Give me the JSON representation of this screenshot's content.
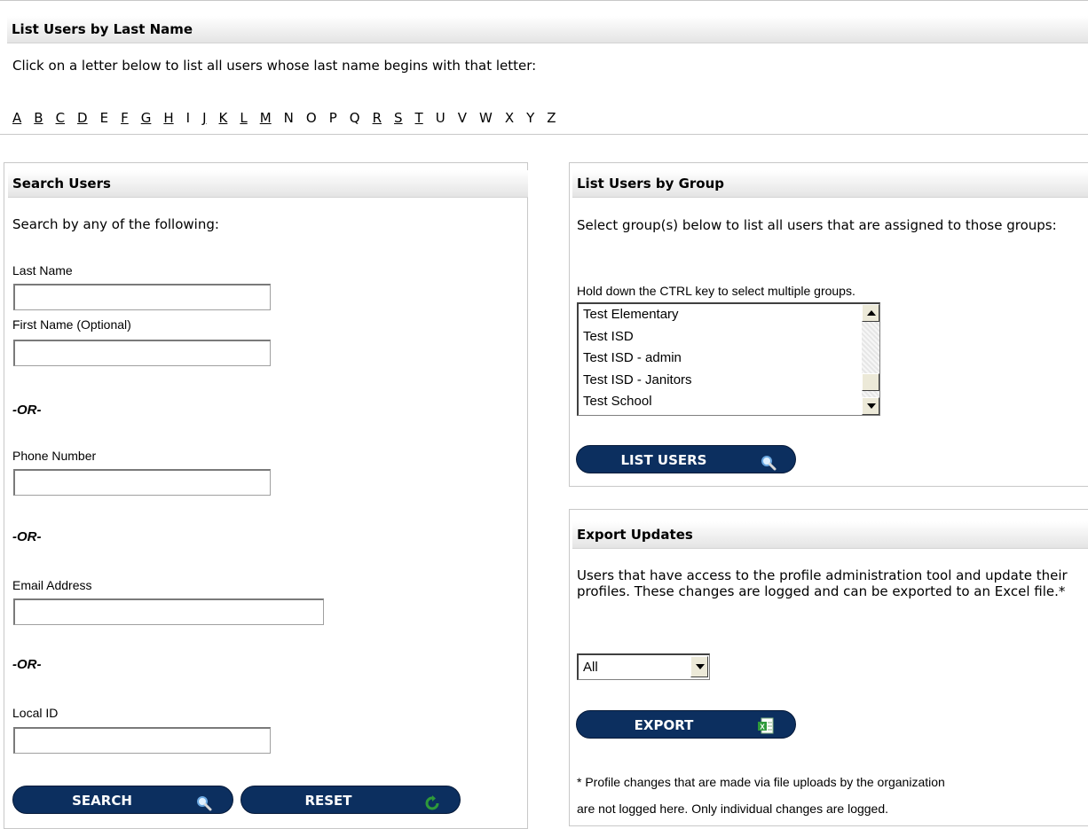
{
  "last_name_panel": {
    "title": "List Users by Last Name",
    "instructions": "Click on a letter below to list all users whose last name begins with that letter:",
    "letters": [
      {
        "letter": "A",
        "link": true
      },
      {
        "letter": "B",
        "link": true
      },
      {
        "letter": "C",
        "link": true
      },
      {
        "letter": "D",
        "link": true
      },
      {
        "letter": "E",
        "link": false
      },
      {
        "letter": "F",
        "link": true
      },
      {
        "letter": "G",
        "link": true
      },
      {
        "letter": "H",
        "link": true
      },
      {
        "letter": "I",
        "link": false
      },
      {
        "letter": "J",
        "link": true
      },
      {
        "letter": "K",
        "link": true
      },
      {
        "letter": "L",
        "link": true
      },
      {
        "letter": "M",
        "link": true
      },
      {
        "letter": "N",
        "link": false
      },
      {
        "letter": "O",
        "link": false
      },
      {
        "letter": "P",
        "link": false
      },
      {
        "letter": "Q",
        "link": false
      },
      {
        "letter": "R",
        "link": true
      },
      {
        "letter": "S",
        "link": true
      },
      {
        "letter": "T",
        "link": true
      },
      {
        "letter": "U",
        "link": false
      },
      {
        "letter": "V",
        "link": false
      },
      {
        "letter": "W",
        "link": false
      },
      {
        "letter": "X",
        "link": false
      },
      {
        "letter": "Y",
        "link": false
      },
      {
        "letter": "Z",
        "link": false
      }
    ]
  },
  "search_panel": {
    "title": "Search Users",
    "subtitle": "Search by any of the following:",
    "last_name_label": "Last Name",
    "last_name_value": "",
    "first_name_label": "First Name (Optional)",
    "first_name_value": "",
    "or_label": "-OR-",
    "phone_label": "Phone Number",
    "phone_value": "",
    "email_label": "Email Address",
    "email_value": "",
    "local_id_label": "Local ID",
    "local_id_value": "",
    "search_button": "SEARCH",
    "reset_button": "RESET"
  },
  "group_panel": {
    "title": "List Users by Group",
    "instructions": "Select group(s) below to list all users that are assigned to those groups:",
    "hint": "Hold down the CTRL key to select multiple groups.",
    "groups": [
      "Test Elementary",
      "Test ISD",
      "Test ISD - admin",
      "Test ISD - Janitors",
      "Test School"
    ],
    "list_button": "LIST USERS"
  },
  "export_panel": {
    "title": "Export Updates",
    "description": "Users that have access to the profile administration tool and update their profiles. These changes are logged and can be exported to an Excel file.*",
    "select_value": "All",
    "export_button": "EXPORT",
    "footnote_line1": "* Profile changes that are made via file uploads by the organization",
    "footnote_line2": "are not logged here. Only individual changes are logged."
  },
  "colors": {
    "button_bg": "#0c2f5f",
    "header_grad_end": "#e4e4e4",
    "icon_green": "#2e9a3a",
    "icon_blue": "#6aa7e0"
  }
}
